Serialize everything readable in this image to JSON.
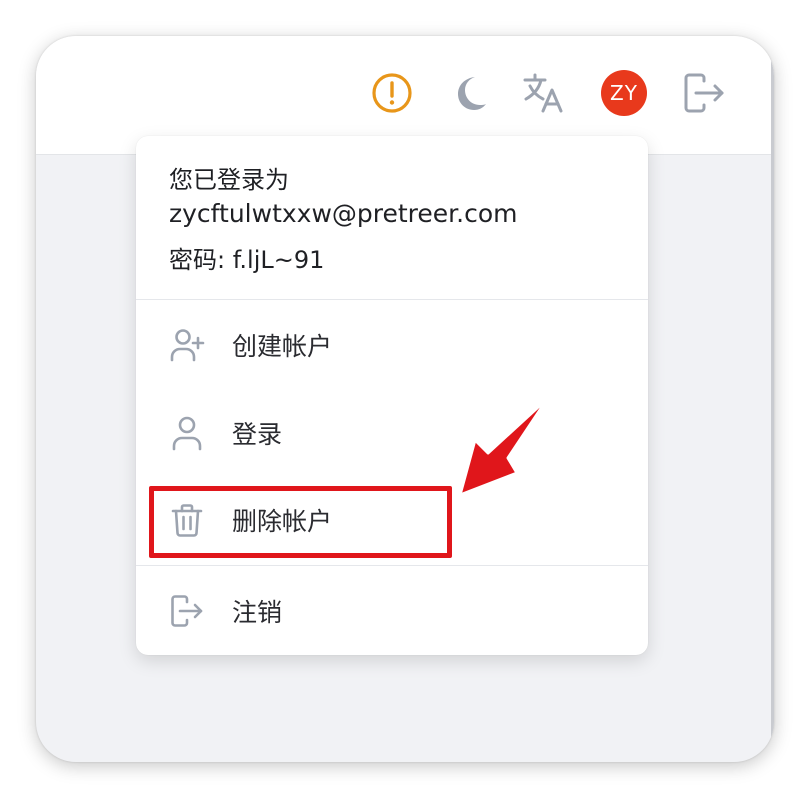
{
  "toolbar": {
    "warning_icon_color": "#e8961a",
    "icon_color": "#9ca3af",
    "avatar_initials": "ZY",
    "avatar_color": "#e8391c"
  },
  "account_menu": {
    "signed_in_as": "您已登录为",
    "email": "zycftulwtxxw@pretreer.com",
    "password_line": "密码: f.ljL~91",
    "items": [
      {
        "label": "创建帐户",
        "icon": "user-plus-icon"
      },
      {
        "label": "登录",
        "icon": "user-icon"
      },
      {
        "label": "删除帐户",
        "icon": "trash-icon"
      },
      {
        "label": "注销",
        "icon": "logout-icon"
      }
    ]
  },
  "annotation": {
    "highlight_color": "#e0161b"
  }
}
